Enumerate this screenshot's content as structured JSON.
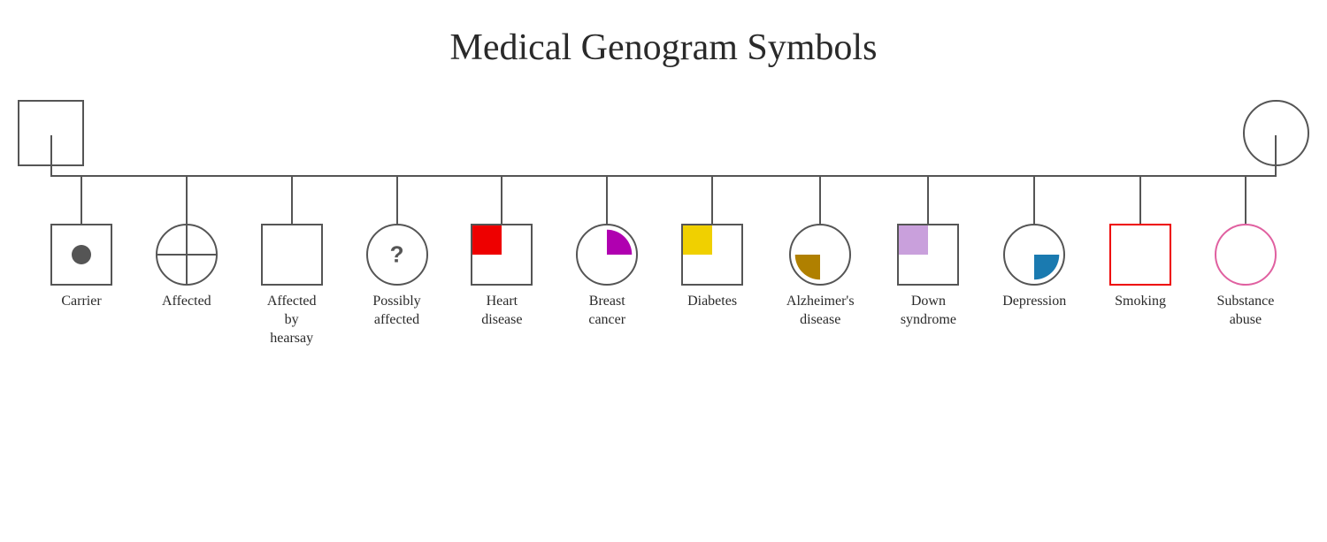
{
  "title": "Medical Genogram Symbols",
  "symbols": [
    {
      "id": "carrier",
      "shape": "square",
      "label": "Carrier"
    },
    {
      "id": "affected",
      "shape": "circle",
      "label": "Affected"
    },
    {
      "id": "affected-by-hearsay",
      "shape": "square",
      "label": "Affected by hearsay"
    },
    {
      "id": "possibly-affected",
      "shape": "circle",
      "label": "Possibly affected"
    },
    {
      "id": "heart-disease",
      "shape": "square",
      "label": "Heart disease"
    },
    {
      "id": "breast-cancer",
      "shape": "circle",
      "label": "Breast cancer"
    },
    {
      "id": "diabetes",
      "shape": "square",
      "label": "Diabetes"
    },
    {
      "id": "alzheimers",
      "shape": "circle",
      "label": "Alzheimer's disease"
    },
    {
      "id": "down-syndrome",
      "shape": "square",
      "label": "Down syndrome"
    },
    {
      "id": "depression",
      "shape": "circle",
      "label": "Depression"
    },
    {
      "id": "smoking",
      "shape": "square-red",
      "label": "Smoking"
    },
    {
      "id": "substance-abuse",
      "shape": "circle-pink",
      "label": "Substance abuse"
    }
  ]
}
